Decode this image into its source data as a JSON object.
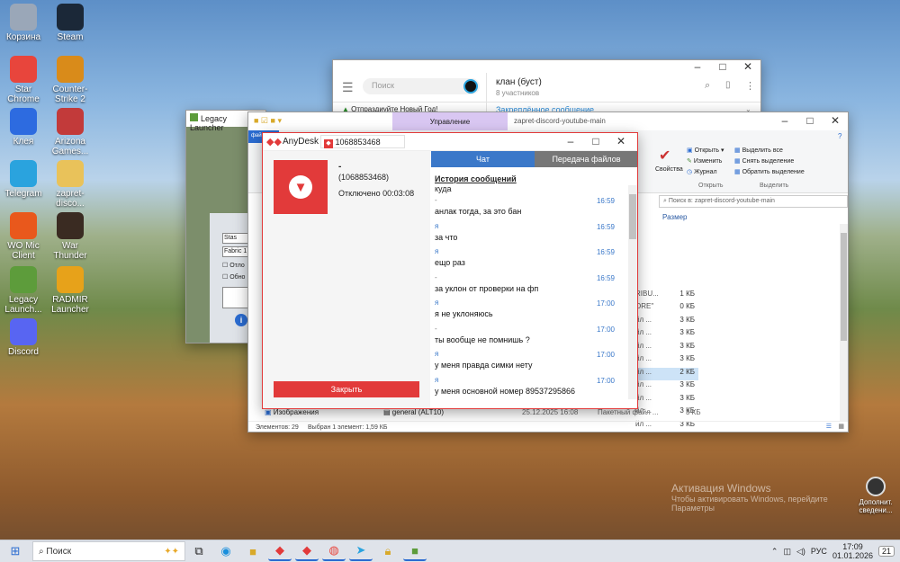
{
  "desktop": {
    "icons": [
      {
        "label": "Корзина",
        "icon": "recycle-bin-icon",
        "color": "#9aa7b8"
      },
      {
        "label": "Steam",
        "icon": "steam-icon",
        "color": "#1b2838"
      },
      {
        "label": "Star Chrome",
        "icon": "chrome-icon",
        "color": "#e8453c"
      },
      {
        "label": "Counter-Strike 2",
        "icon": "cs2-icon",
        "color": "#d98b1a"
      },
      {
        "label": "Клея",
        "icon": "zoom-icon",
        "color": "#2d6be0"
      },
      {
        "label": "Arizona Games...",
        "icon": "arizona-icon",
        "color": "#c23a3a"
      },
      {
        "label": "Telegram",
        "icon": "telegram-icon",
        "color": "#2aa3de"
      },
      {
        "label": "zapret-disco...",
        "icon": "folder-icon",
        "color": "#e9c25a"
      },
      {
        "label": "WO Mic Client",
        "icon": "mic-icon",
        "color": "#e9581c"
      },
      {
        "label": "War Thunder",
        "icon": "warthunder-icon",
        "color": "#3a2b22"
      },
      {
        "label": "Legacy Launch...",
        "icon": "minecraft-icon",
        "color": "#5d9c3b"
      },
      {
        "label": "RADMIR Launcher",
        "icon": "radmir-icon",
        "color": "#e7a21a"
      },
      {
        "label": "Discord",
        "icon": "discord-icon",
        "color": "#5865f2"
      }
    ],
    "watermark_title": "Активация Windows",
    "watermark_line1": "Чтобы активировать Windows, перейдите",
    "watermark_line2": "Параметры",
    "notif_label_1": "Дополнит.",
    "notif_label_2": "сведени..."
  },
  "telegram": {
    "search_placeholder": "Поиск",
    "chat_title": "клан (буст)",
    "chat_subtitle": "8 участников",
    "pinned_label": "Закреплённое сообщение",
    "pinned_chat": "Отпраздиуйте Новый Год!"
  },
  "legacy": {
    "title": "Legacy Launcher",
    "field1": "Stas",
    "field2": "Fabric 1",
    "check1": "Отло",
    "check2": "Обно"
  },
  "explorer": {
    "ribbon_tab": "Управление",
    "title": "zapret-discord-youtube-main",
    "properties_label": "Свойства",
    "open_label": "Открыть",
    "edit_label": "Изменить",
    "journal_label": "Журнал",
    "open_group": "Открыть",
    "select_all": "Выделить все",
    "deselect": "Снять выделение",
    "invert": "Обратить выделение",
    "select_group": "Выделить",
    "search_placeholder": "Поиск в: zapret-discord-youtube-main",
    "col_size": "Размер",
    "sizes": [
      "",
      "",
      "",
      "",
      "",
      "1 КБ",
      "0 КБ",
      "3 КБ",
      "3 КБ",
      "3 КБ",
      "3 КБ",
      "2 КБ",
      "3 КБ",
      "3 КБ",
      "3 КБ",
      "3 КБ",
      "3 КБ",
      "3 КБ"
    ],
    "frag": [
      "",
      "",
      "",
      "",
      "",
      "RIBU...",
      "ORE\"",
      "йл ...",
      "йл ...",
      "йл ...",
      "йл ...",
      "йл ...",
      "йл ...",
      "йл ...",
      "йл ...",
      "йл ...",
      "йл ...",
      "йл ..."
    ],
    "bottom_nav": "Изображения",
    "bottom_file": "general (ALT10)",
    "bottom_date": "25.12.2025 16:08",
    "bottom_type": "Пакетный файл ...",
    "bottom_size": "3 КБ",
    "status_count": "Элементов: 29",
    "status_selected": "Выбран 1 элемент: 1,59 КБ"
  },
  "anydesk": {
    "app_name": "AnyDesk",
    "address": "1068853468",
    "peer_name": "-",
    "peer_id": "(1068853468)",
    "status": "Отключено 00:03:08",
    "close_button": "Закрыть",
    "tab_chat": "Чат",
    "tab_files": "Передача файлов",
    "history_title": "История сообщений",
    "first_line": "куда",
    "messages": [
      {
        "who": "-",
        "time": "16:59",
        "text": "анлак тогда, за это бан"
      },
      {
        "who": "я",
        "time": "16:59",
        "text": "за что"
      },
      {
        "who": "я",
        "time": "16:59",
        "text": "ещо раз"
      },
      {
        "who": "-",
        "time": "16:59",
        "text": "за уклон от проверки на фп"
      },
      {
        "who": "я",
        "time": "17:00",
        "text": "я не уклоняюсь"
      },
      {
        "who": "-",
        "time": "17:00",
        "text": "ты вообще не помнишь ?"
      },
      {
        "who": "я",
        "time": "17:00",
        "text": "у меня правда симки нету"
      },
      {
        "who": "я",
        "time": "17:00",
        "text": "у меня основной номер 89537295866"
      }
    ]
  },
  "taskbar": {
    "search_placeholder": "Поиск",
    "lang": "РУС",
    "time": "17:09",
    "date": "01.01.2026",
    "notif_count": "21"
  }
}
